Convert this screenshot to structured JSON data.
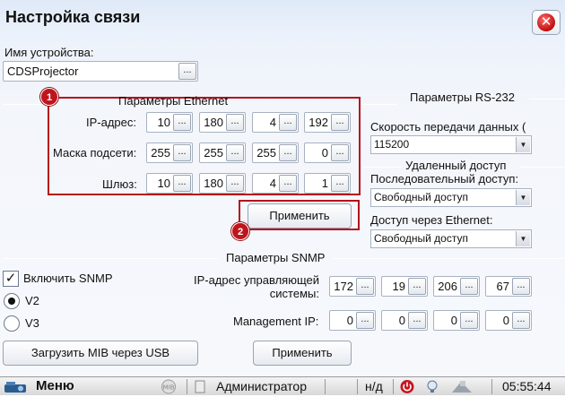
{
  "window": {
    "title": "Настройка связи"
  },
  "device": {
    "label": "Имя устройства:",
    "value": "CDSProjector"
  },
  "ethernet": {
    "group_title": "Параметры Ethernet",
    "ip_label": "IP-адрес:",
    "ip": [
      "10",
      "180",
      "4",
      "192"
    ],
    "mask_label": "Маска подсети:",
    "mask": [
      "255",
      "255",
      "255",
      "0"
    ],
    "gateway_label": "Шлюз:",
    "gateway": [
      "10",
      "180",
      "4",
      "1"
    ],
    "apply_label": "Применить"
  },
  "rs232": {
    "group_title": "Параметры RS-232",
    "speed_label": "Скорость передачи данных (",
    "speed_value": "115200"
  },
  "remote": {
    "group_title": "Удаленный доступ",
    "serial_label": "Последовательный доступ:",
    "serial_value": "Свободный доступ",
    "ethernet_label": "Доступ через Ethernet:",
    "ethernet_value": "Свободный доступ"
  },
  "snmp": {
    "group_title": "Параметры SNMP",
    "enable_label": "Включить SNMP",
    "enabled": true,
    "v2_label": "V2",
    "v3_label": "V3",
    "selected_version": "V2",
    "mgmt_system_label_line1": "IP-адрес управляющей",
    "mgmt_system_label_line2": "системы:",
    "mgmt_system_ip": [
      "172",
      "19",
      "206",
      "67"
    ],
    "mgmt_ip_label": "Management IP:",
    "mgmt_ip": [
      "0",
      "0",
      "0",
      "0"
    ],
    "load_mib_label": "Загрузить MIB через USB",
    "apply_label": "Применить"
  },
  "annotations": {
    "badge1": "1",
    "badge2": "2",
    "box_color": "#b5121b"
  },
  "ellipsis": "...",
  "taskbar": {
    "menu_label": "Меню",
    "mib_label": "MIB",
    "user_label": "Администратор",
    "status_label": "н/д",
    "time": "05:55:44"
  }
}
